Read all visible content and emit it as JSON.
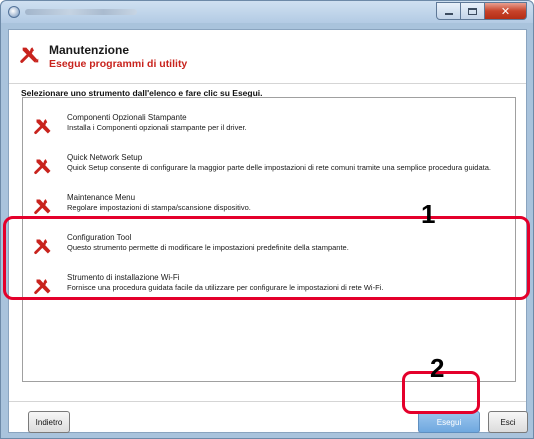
{
  "window": {
    "controls": {
      "minimize_icon": "minimize-icon",
      "maximize_icon": "maximize-icon",
      "close_icon": "close-icon",
      "close_glyph": "✕"
    }
  },
  "header": {
    "title": "Manutenzione",
    "subtitle": "Esegue programmi di utility",
    "icon": "tools-icon"
  },
  "instruction": "Selezionare uno strumento dall'elenco e fare clic su Esegui.",
  "items": [
    {
      "name": "Componenti Opzionali Stampante",
      "description": "Installa i Componenti opzionali stampante per il driver.",
      "icon": "tools-icon"
    },
    {
      "name": "Quick Network Setup",
      "description": "Quick Setup consente di configurare la maggior parte delle impostazioni di rete comuni tramite una semplice procedura guidata.",
      "icon": "tools-icon"
    },
    {
      "name": "Maintenance Menu",
      "description": "Regolare impostazioni di stampa/scansione dispositivo.",
      "icon": "tools-icon"
    },
    {
      "name": "Configuration Tool",
      "description": "Questo strumento permette di modificare le impostazioni predefinite della stampante.",
      "icon": "tools-icon"
    },
    {
      "name": "Strumento di installazione Wi-Fi",
      "description": "Fornisce una procedura guidata facile da utilizzare per configurare le impostazioni di rete Wi-Fi.",
      "icon": "tools-icon"
    }
  ],
  "callouts": {
    "step1": "1",
    "step2": "2"
  },
  "footer": {
    "back_label": "Indietro",
    "run_label": "Esegui",
    "exit_label": "Esci"
  },
  "colors": {
    "accent_red": "#e4002b",
    "subtitle_red": "#c8231d",
    "run_button_blue": "#6fa8df"
  }
}
